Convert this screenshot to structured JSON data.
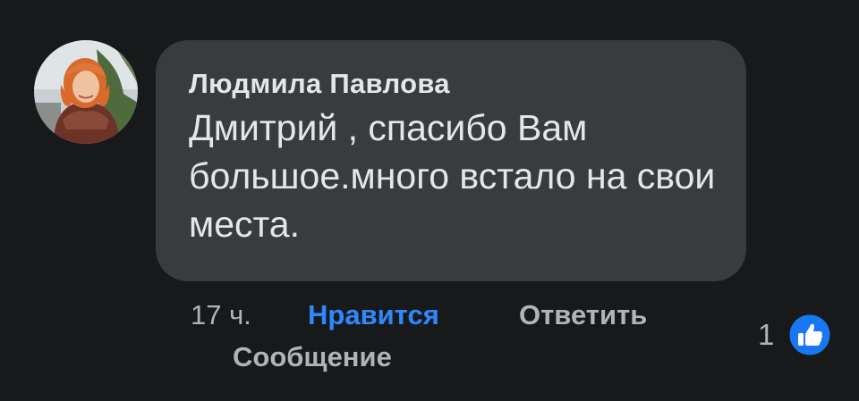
{
  "comment": {
    "author": "Людмила Павлова",
    "text": "Дмитрий , спасибо Вам большое.много встало на свои места.",
    "time": "17 ч.",
    "like_label": "Нравится",
    "reply_label": "Ответить",
    "message_label": "Сообщение",
    "reaction_count": "1",
    "avatar_icon": "profile-photo",
    "reaction_icon": "thumbs-up-icon"
  },
  "colors": {
    "background": "#18191a",
    "bubble": "#3a3b3c",
    "text": "#e4e6eb",
    "secondary_text": "#b0b3b8",
    "accent": "#2d88ff"
  }
}
